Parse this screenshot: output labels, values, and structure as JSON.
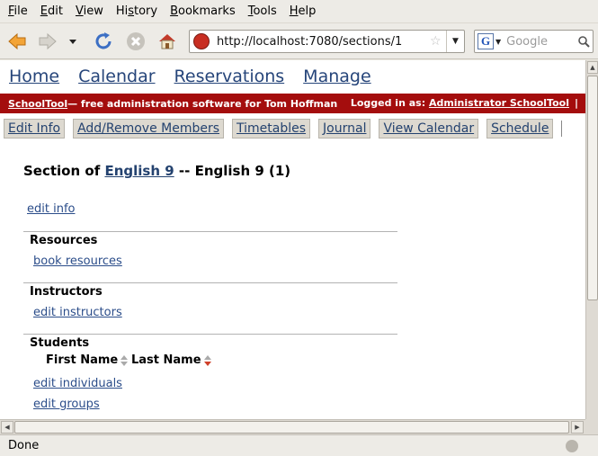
{
  "browser": {
    "menu": [
      {
        "acc": "F",
        "rest": "ile"
      },
      {
        "acc": "E",
        "rest": "dit"
      },
      {
        "acc": "V",
        "rest": "iew"
      },
      {
        "acc": "",
        "pre": "Hi",
        "acc2": "s",
        "rest": "tory"
      },
      {
        "acc": "B",
        "rest": "ookmarks"
      },
      {
        "acc": "T",
        "rest": "ools"
      },
      {
        "acc": "H",
        "rest": "elp"
      }
    ],
    "url": "http://localhost:7080/sections/1",
    "search_placeholder": "Google",
    "status": "Done"
  },
  "site": {
    "nav": [
      "Home",
      "Calendar",
      "Reservations",
      "Manage"
    ],
    "banner_app": "SchoolTool",
    "banner_tagline": " — free administration software for Tom Hoffman",
    "logged_in_label": "Logged in as: ",
    "logged_in_user": "Administrator SchoolTool",
    "logged_in_sep": "|",
    "tabs": [
      "Edit Info",
      "Add/Remove Members",
      "Timetables",
      "Journal",
      "View Calendar",
      "Schedule"
    ]
  },
  "section": {
    "title_prefix": "Section of ",
    "course_link": "English 9",
    "title_suffix": " -- English 9 (1)",
    "edit_info": "edit info",
    "resources_head": "Resources",
    "resources_link": "book resources",
    "instructors_head": "Instructors",
    "instructors_link": "edit instructors",
    "students_head": "Students",
    "col_first": "First Name",
    "col_last": "Last Name",
    "students_link1": "edit individuals",
    "students_link2": "edit groups"
  },
  "colors": {
    "banner": "#a40d0d",
    "link": "#24426f"
  }
}
